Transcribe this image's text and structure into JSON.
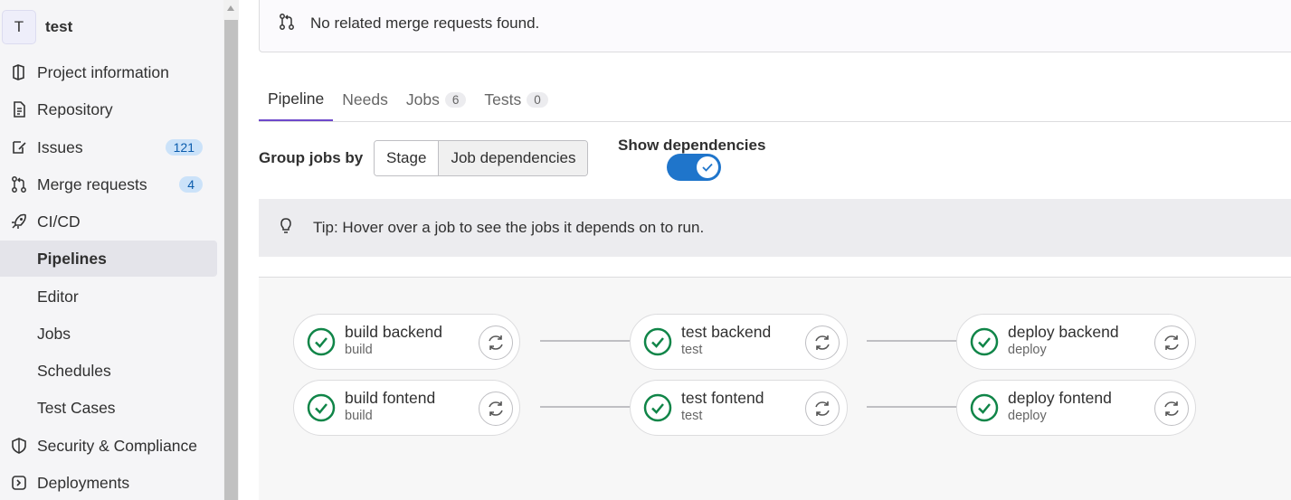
{
  "project": {
    "avatar_letter": "T",
    "name": "test"
  },
  "sidebar": {
    "items": [
      {
        "label": "Project information",
        "icon": "project-info-icon"
      },
      {
        "label": "Repository",
        "icon": "document-icon"
      },
      {
        "label": "Issues",
        "icon": "issues-icon",
        "badge": "121"
      },
      {
        "label": "Merge requests",
        "icon": "merge-request-icon",
        "badge": "4"
      },
      {
        "label": "CI/CD",
        "icon": "rocket-icon"
      },
      {
        "label": "Pipelines"
      },
      {
        "label": "Editor"
      },
      {
        "label": "Jobs"
      },
      {
        "label": "Schedules"
      },
      {
        "label": "Test Cases"
      },
      {
        "label": "Security & Compliance",
        "icon": "shield-icon"
      },
      {
        "label": "Deployments",
        "icon": "deployments-icon"
      }
    ]
  },
  "merge_requests": {
    "text": "No related merge requests found."
  },
  "tabs": [
    {
      "label": "Pipeline",
      "active": true
    },
    {
      "label": "Needs"
    },
    {
      "label": "Jobs",
      "count": "6"
    },
    {
      "label": "Tests",
      "count": "0"
    }
  ],
  "group_by": {
    "label": "Group jobs by",
    "options": [
      "Stage",
      "Job dependencies"
    ],
    "selected": "Job dependencies"
  },
  "dependencies_toggle": {
    "label": "Show dependencies",
    "on": true
  },
  "tip": {
    "text": "Tip: Hover over a job to see the jobs it depends on to run."
  },
  "jobs": [
    {
      "name": "build backend",
      "stage": "build",
      "status": "success"
    },
    {
      "name": "build fontend",
      "stage": "build",
      "status": "success"
    },
    {
      "name": "test backend",
      "stage": "test",
      "status": "success"
    },
    {
      "name": "test fontend",
      "stage": "test",
      "status": "success"
    },
    {
      "name": "deploy backend",
      "stage": "deploy",
      "status": "success"
    },
    {
      "name": "deploy fontend",
      "stage": "deploy",
      "status": "success"
    }
  ],
  "colors": {
    "success": "#108548",
    "accent": "#6e49cb",
    "toggle": "#1f75cb",
    "badge_bg": "#cbe2f9"
  }
}
